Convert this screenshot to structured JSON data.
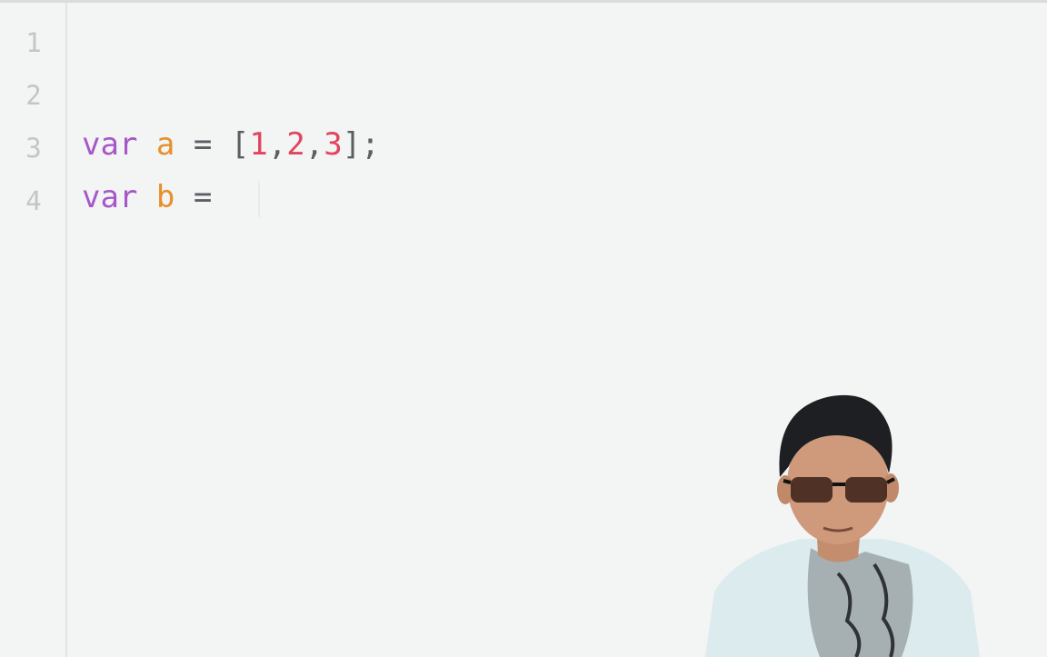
{
  "gutter": {
    "line_numbers": [
      "1",
      "2",
      "3",
      "4"
    ]
  },
  "code": {
    "line3": {
      "keyword": "var",
      "name": "a",
      "op": "=",
      "open": "[",
      "n1": "1",
      "c1": ",",
      "n2": "2",
      "c2": ",",
      "n3": "3",
      "close": "];"
    },
    "line4": {
      "keyword": "var",
      "name": "b",
      "op": "="
    }
  },
  "colors": {
    "background": "#f3f4f4",
    "keyword": "#a757c9",
    "identifier": "#e8902a",
    "number": "#e2445d",
    "line_number": "#c3c6c8"
  },
  "overlay": {
    "icon": "presenter-webcam-icon"
  }
}
